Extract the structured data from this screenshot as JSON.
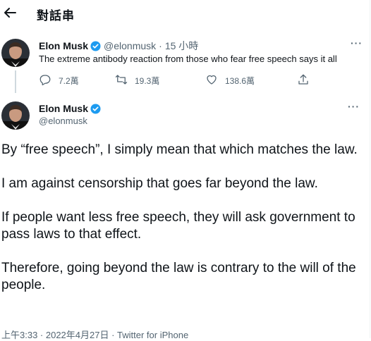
{
  "header": {
    "title": "對話串",
    "back_icon": "arrow-left-icon"
  },
  "tweet1": {
    "name": "Elon Musk",
    "handle": "@elonmusk",
    "separator": "·",
    "time": "15 小時",
    "text": "The extreme antibody reaction from those who fear free speech says it all",
    "more": "···",
    "actions": {
      "replies": "7.2萬",
      "retweets": "19.3萬",
      "likes": "138.6萬"
    }
  },
  "tweet2": {
    "name": "Elon Musk",
    "handle": "@elonmusk",
    "more": "···",
    "paragraphs": [
      "By “free speech”, I simply mean that which matches the law.",
      "I am against censorship that goes far beyond the law.",
      "If people want less free speech, they will ask government to pass laws to that effect.",
      "Therefore, going beyond the law is contrary to the will of the people."
    ],
    "meta": "上午3:33 · 2022年4月27日 · Twitter for iPhone"
  },
  "colors": {
    "verified": "#1d9bf0",
    "secondary_text": "#536471",
    "text": "#0f1419"
  }
}
